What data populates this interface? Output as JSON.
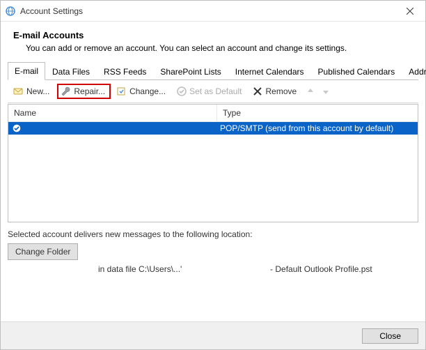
{
  "window": {
    "title": "Account Settings"
  },
  "heading": {
    "title": "E-mail Accounts",
    "description": "You can add or remove an account. You can select an account and change its settings."
  },
  "tabs": [
    {
      "label": "E-mail",
      "active": true
    },
    {
      "label": "Data Files",
      "active": false
    },
    {
      "label": "RSS Feeds",
      "active": false
    },
    {
      "label": "SharePoint Lists",
      "active": false
    },
    {
      "label": "Internet Calendars",
      "active": false
    },
    {
      "label": "Published Calendars",
      "active": false
    },
    {
      "label": "Address Books",
      "active": false
    }
  ],
  "toolbar": {
    "new_label": "New...",
    "repair_label": "Repair...",
    "change_label": "Change...",
    "set_default_label": "Set as Default",
    "remove_label": "Remove"
  },
  "list": {
    "columns": {
      "name": "Name",
      "type": "Type"
    },
    "rows": [
      {
        "name": "",
        "type": "POP/SMTP (send from this account by default)",
        "selected": true,
        "default": true
      }
    ]
  },
  "location": {
    "label": "Selected account delivers new messages to the following location:",
    "change_folder_label": "Change Folder",
    "prefix": "in data file C:\\Users\\...'",
    "suffix": "- Default Outlook Profile.pst"
  },
  "footer": {
    "close_label": "Close"
  }
}
